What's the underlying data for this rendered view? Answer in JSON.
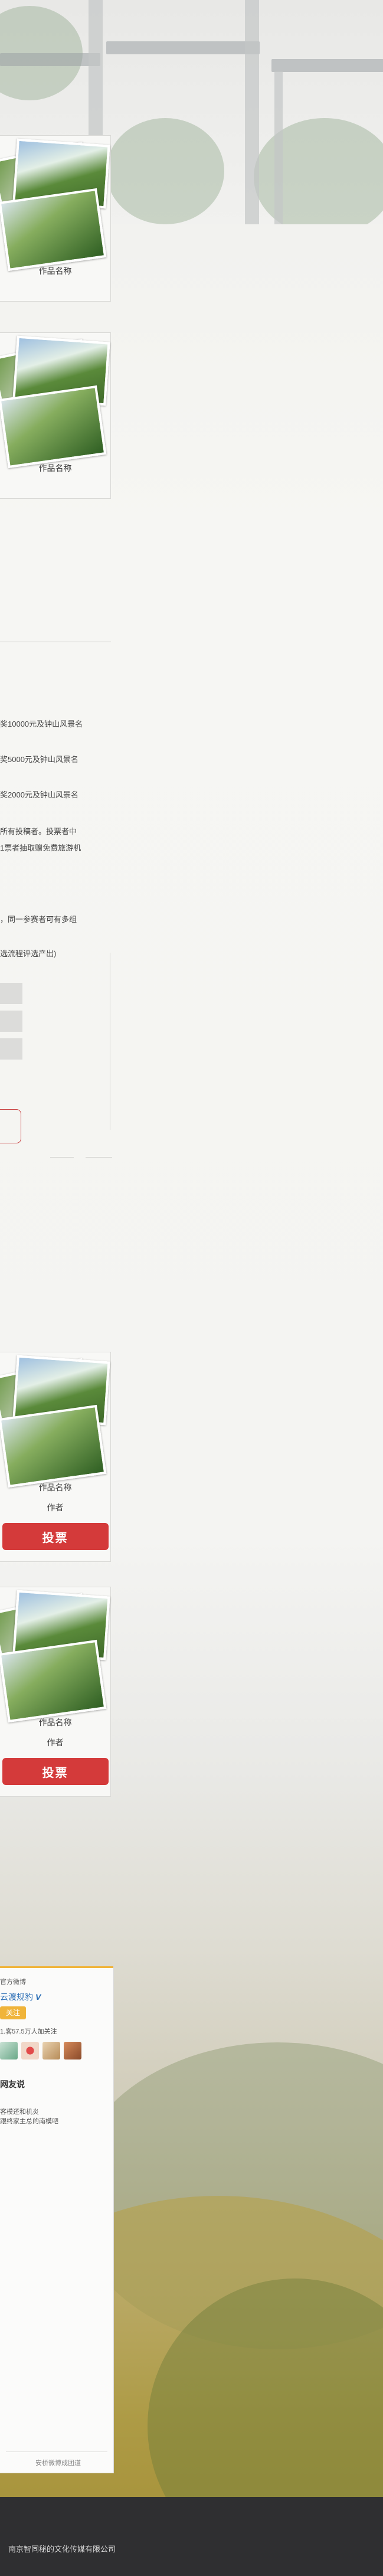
{
  "cards_top": [
    {
      "title": "作品名称"
    },
    {
      "title": "作品名称"
    }
  ],
  "rules": {
    "lines": [
      "奖10000元及钟山风景名",
      "奖5000元及钟山风景名",
      "奖2000元及钟山风景名",
      "所有投稿者。投票者中",
      "1票者抽取赠免费旅游机",
      "，同一参赛者可有多组",
      "选流程评选产出)"
    ]
  },
  "cards_bottom": [
    {
      "title": "作品名称",
      "author": "作者",
      "vote_label": "投票"
    },
    {
      "title": "作品名称",
      "author": "作者",
      "vote_label": "投票"
    }
  ],
  "weibo": {
    "official": "官方微博",
    "name": "云渡规豹",
    "verified": "V",
    "follow_label": "关注",
    "fans": "1.客57.5万人加关注",
    "section_title": "网友说",
    "post_line1": "客模还和机炎",
    "post_line2": "跟终家主总的南模吧",
    "footer": "安桥微博成团道"
  },
  "footer": {
    "copyright": "南京智同秘的文化传媒有限公司"
  },
  "colors": {
    "vote_red": "#d43a3a",
    "weibo_orange": "#f0b43a",
    "weibo_blue": "#2c6fb6",
    "footer_bg": "#2f2f31"
  }
}
